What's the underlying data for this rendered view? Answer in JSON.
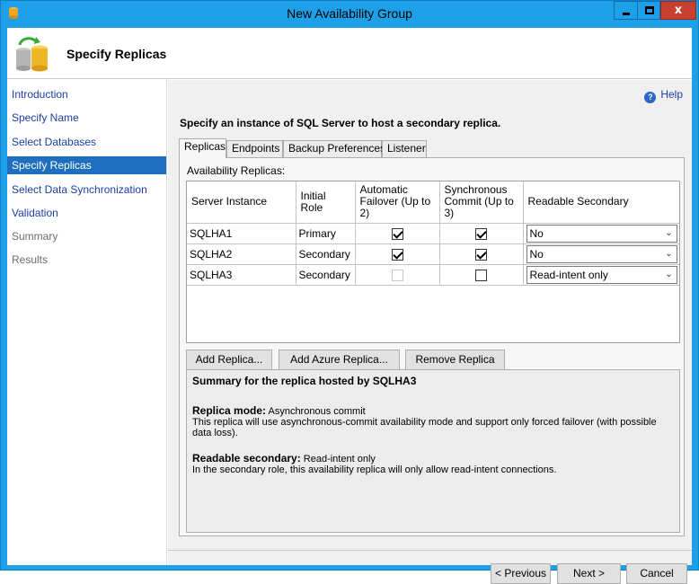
{
  "window": {
    "title": "New Availability Group",
    "close_glyph": "x"
  },
  "header": {
    "title": "Specify Replicas",
    "icon": "database-replicas-icon"
  },
  "sidebar": {
    "items": [
      {
        "label": "Introduction",
        "state": "link"
      },
      {
        "label": "Specify Name",
        "state": "link"
      },
      {
        "label": "Select Databases",
        "state": "link"
      },
      {
        "label": "Specify Replicas",
        "state": "active"
      },
      {
        "label": "Select Data Synchronization",
        "state": "link"
      },
      {
        "label": "Validation",
        "state": "link"
      },
      {
        "label": "Summary",
        "state": "disabled"
      },
      {
        "label": "Results",
        "state": "disabled"
      }
    ]
  },
  "main": {
    "help_label": "Help",
    "help_glyph": "?",
    "instruction": "Specify an instance of SQL Server to host a secondary replica.",
    "tabs": [
      {
        "label": "Replicas",
        "active": true
      },
      {
        "label": "Endpoints",
        "active": false
      },
      {
        "label": "Backup Preferences",
        "active": false
      },
      {
        "label": "Listener",
        "active": false
      }
    ],
    "grid_label": "Availability Replicas:",
    "columns": [
      "Server Instance",
      "Initial Role",
      "Automatic Failover (Up to 2)",
      "Synchronous Commit (Up to 3)",
      "Readable Secondary"
    ],
    "rows": [
      {
        "server": "SQLHA1",
        "role": "Primary",
        "failover": true,
        "failover_enabled": true,
        "sync": true,
        "readable": "No"
      },
      {
        "server": "SQLHA2",
        "role": "Secondary",
        "failover": true,
        "failover_enabled": true,
        "sync": true,
        "readable": "No"
      },
      {
        "server": "SQLHA3",
        "role": "Secondary",
        "failover": false,
        "failover_enabled": false,
        "sync": false,
        "readable": "Read-intent only"
      }
    ],
    "buttons": {
      "add_replica": "Add Replica...",
      "add_azure_replica": "Add Azure Replica...",
      "remove_replica": "Remove Replica"
    },
    "summary": {
      "title": "Summary for the replica hosted by SQLHA3",
      "replica_mode_label": "Replica mode:",
      "replica_mode_value": "Asynchronous commit",
      "replica_mode_desc": "This replica will use asynchronous-commit availability mode and support only forced failover (with possible data loss).",
      "readable_label": "Readable secondary:",
      "readable_value": "Read-intent only",
      "readable_desc": "In the secondary role, this availability replica will only allow read-intent connections."
    }
  },
  "footer": {
    "previous": "< Previous",
    "next": "Next >",
    "cancel": "Cancel"
  },
  "colors": {
    "titlebar": "#1ea0e8",
    "active_nav": "#1e6fbf",
    "link": "#1a3ea6",
    "close_button": "#c7402f"
  }
}
